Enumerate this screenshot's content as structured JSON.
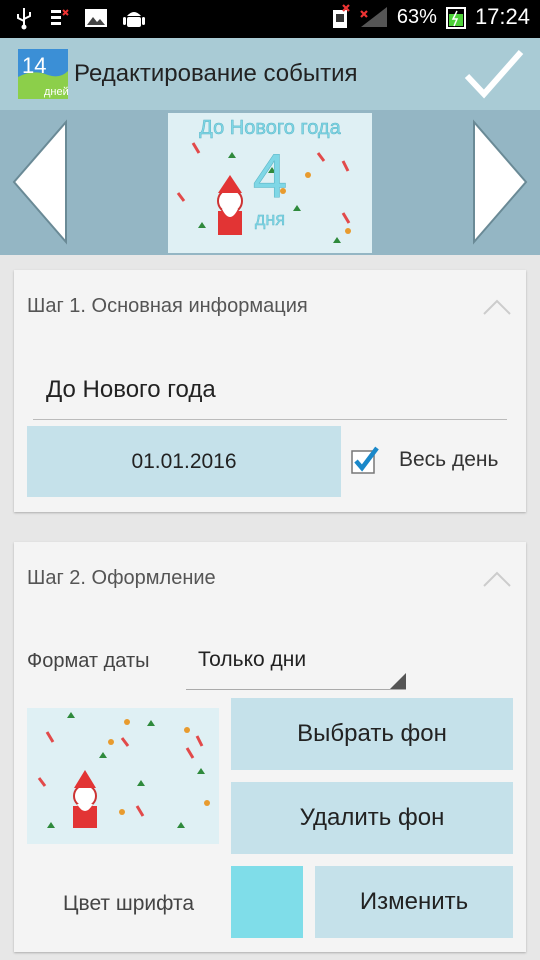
{
  "status_bar": {
    "battery": "63%",
    "time": "17:24",
    "icons": [
      "usb-icon",
      "debug-icon",
      "image-icon",
      "android-icon",
      "sim-icon",
      "signal-icon",
      "battery-icon"
    ]
  },
  "action_bar": {
    "app_icon_number": "14",
    "app_icon_caption": "дней",
    "title": "Редактирование события",
    "confirm_icon": "check-icon"
  },
  "preview": {
    "title": "До Нового года",
    "number": "4",
    "days": "дня",
    "prev_icon": "arrow-left-icon",
    "next_icon": "arrow-right-icon"
  },
  "step1": {
    "title": "Шаг 1. Основная информация",
    "event_name": "До Нового года",
    "date": "01.01.2016",
    "all_day_label": "Весь день",
    "all_day_checked": true
  },
  "step2": {
    "title": "Шаг 2. Оформление",
    "format_label": "Формат даты",
    "format_value": "Только дни",
    "pick_bg": "Выбрать фон",
    "delete_bg": "Удалить фон",
    "font_color_label": "Цвет шрифта",
    "font_color": "#7fdde9",
    "change": "Изменить"
  },
  "colors": {
    "action_bar": "#a9cbd5",
    "preview_strip": "#94b6c4",
    "button": "#c5e1ea",
    "checkbox": "#1a88c9"
  }
}
